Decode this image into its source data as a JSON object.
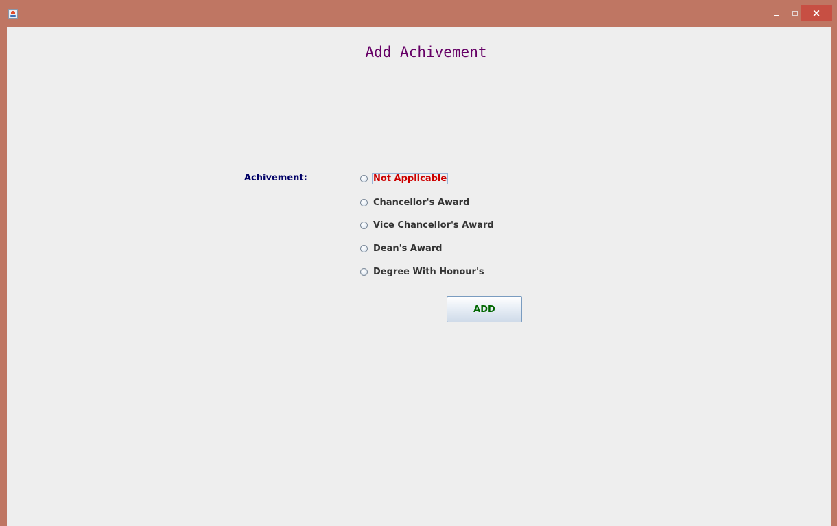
{
  "window": {
    "icon": "java-cup-icon",
    "controls": {
      "minimize_icon": "minimize-icon",
      "maximize_icon": "maximize-icon",
      "close_label": "×"
    }
  },
  "form": {
    "title": "Add Achivement",
    "field_label": "Achivement:",
    "options": [
      {
        "label": "Not Applicable",
        "selected": false,
        "focused": true
      },
      {
        "label": "Chancellor's Award",
        "selected": false
      },
      {
        "label": "Vice Chancellor's Award",
        "selected": false
      },
      {
        "label": "Dean's Award",
        "selected": false
      },
      {
        "label": "Degree With Honour's",
        "selected": false
      }
    ],
    "add_label": "ADD"
  },
  "colors": {
    "title": "#660066",
    "label": "#000066",
    "focused_option": "#cc0000",
    "option": "#333333",
    "add_text": "#006600",
    "frame": "#bf7663",
    "client_bg": "#eeeeee"
  }
}
